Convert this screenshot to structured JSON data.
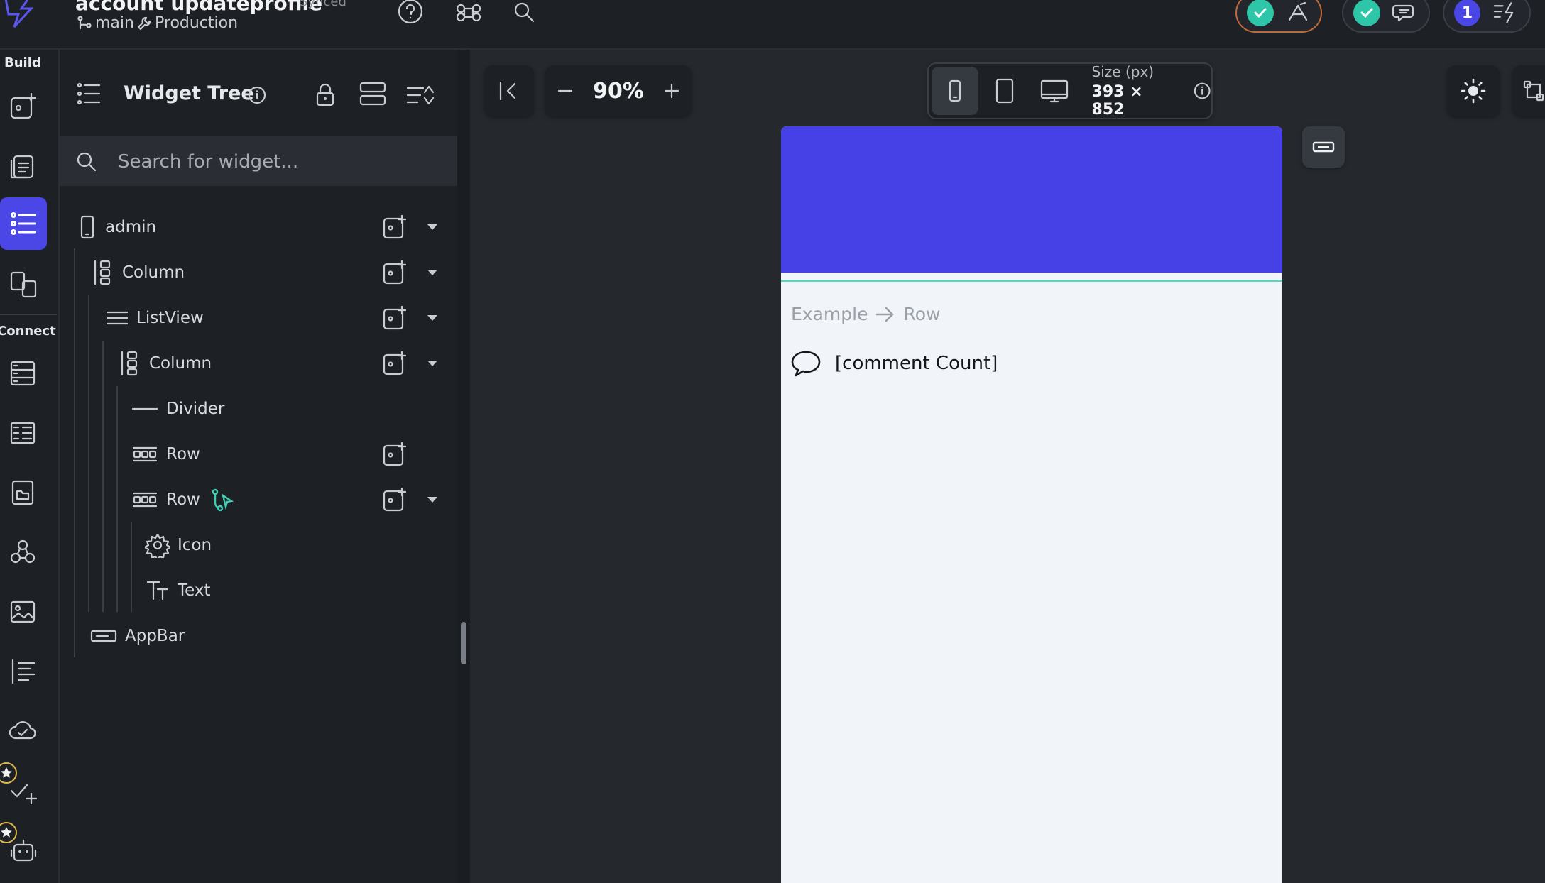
{
  "header": {
    "project_title": "account updateprofile",
    "sync_status": "Synced",
    "branch": "main",
    "environment": "Production",
    "notification_count": "1"
  },
  "rail": {
    "build_label": "Build",
    "connect_label": "Connect"
  },
  "widget_tree": {
    "title": "Widget Tree",
    "search_placeholder": "Search for widget...",
    "nodes": [
      {
        "label": "admin",
        "icon": "phone-icon"
      },
      {
        "label": "Column",
        "icon": "column-icon"
      },
      {
        "label": "ListView",
        "icon": "listview-icon"
      },
      {
        "label": "Column",
        "icon": "column-icon"
      },
      {
        "label": "Divider",
        "icon": "divider-icon"
      },
      {
        "label": "Row",
        "icon": "row-icon"
      },
      {
        "label": "Row",
        "icon": "row-icon"
      },
      {
        "label": "Icon",
        "icon": "gear-icon"
      },
      {
        "label": "Text",
        "icon": "text-icon"
      },
      {
        "label": "AppBar",
        "icon": "appbar-icon"
      }
    ]
  },
  "canvas": {
    "zoom": "90%",
    "size_label": "Size (px)",
    "size_value": "393 × 852"
  },
  "preview": {
    "breadcrumb": [
      "Example",
      "Row"
    ],
    "comment_text": "[comment Count]"
  },
  "colors": {
    "accent": "#4b47e6",
    "appbar": "#4541e6",
    "teal": "#2dc6a8",
    "background": "#1d2025"
  }
}
